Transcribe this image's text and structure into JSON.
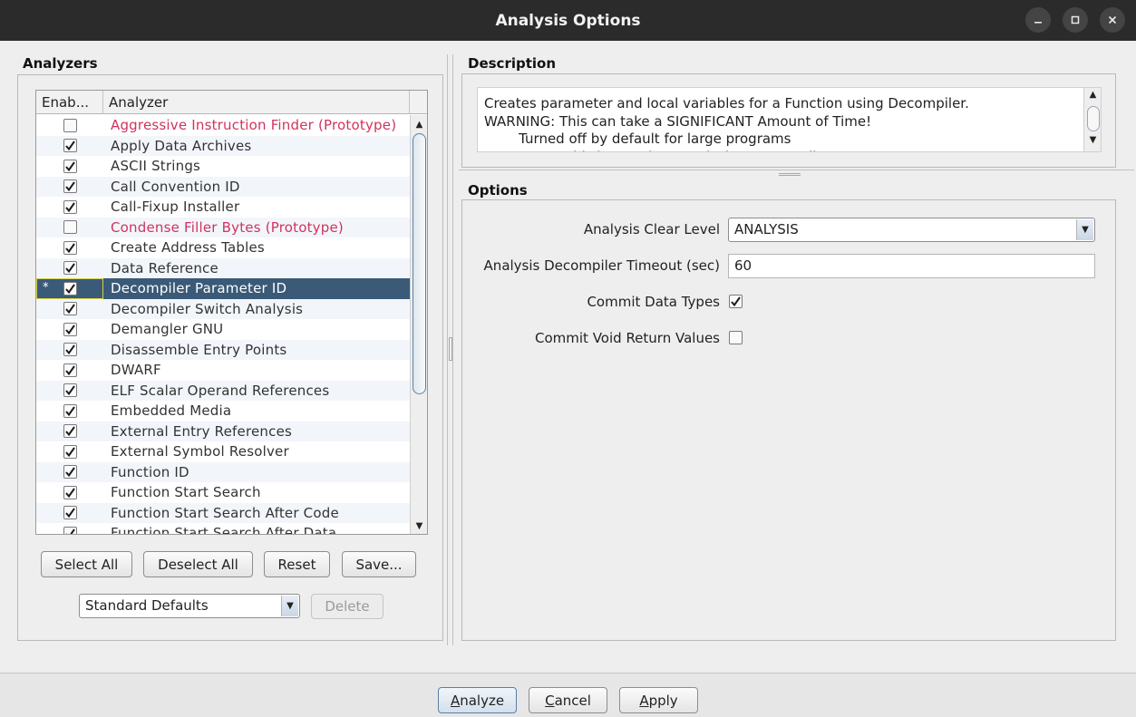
{
  "window": {
    "title": "Analysis Options",
    "controls": [
      "minimize-icon",
      "maximize-icon",
      "close-icon"
    ]
  },
  "analyzers": {
    "section_title": "Analyzers",
    "columns": [
      "Enab...",
      "Analyzer"
    ],
    "rows": [
      {
        "enabled": false,
        "name": "Aggressive Instruction Finder (Prototype)",
        "prototype": true
      },
      {
        "enabled": true,
        "name": "Apply Data Archives",
        "prototype": false
      },
      {
        "enabled": true,
        "name": "ASCII Strings",
        "prototype": false
      },
      {
        "enabled": true,
        "name": "Call Convention ID",
        "prototype": false
      },
      {
        "enabled": true,
        "name": "Call-Fixup Installer",
        "prototype": false
      },
      {
        "enabled": false,
        "name": "Condense Filler Bytes (Prototype)",
        "prototype": true
      },
      {
        "enabled": true,
        "name": "Create Address Tables",
        "prototype": false
      },
      {
        "enabled": true,
        "name": "Data Reference",
        "prototype": false
      },
      {
        "enabled": true,
        "name": "Decompiler Parameter ID",
        "prototype": false,
        "selected": true,
        "marker": "*"
      },
      {
        "enabled": true,
        "name": "Decompiler Switch Analysis",
        "prototype": false
      },
      {
        "enabled": true,
        "name": "Demangler GNU",
        "prototype": false
      },
      {
        "enabled": true,
        "name": "Disassemble Entry Points",
        "prototype": false
      },
      {
        "enabled": true,
        "name": "DWARF",
        "prototype": false
      },
      {
        "enabled": true,
        "name": "ELF Scalar Operand References",
        "prototype": false
      },
      {
        "enabled": true,
        "name": "Embedded Media",
        "prototype": false
      },
      {
        "enabled": true,
        "name": "External Entry References",
        "prototype": false
      },
      {
        "enabled": true,
        "name": "External Symbol Resolver",
        "prototype": false
      },
      {
        "enabled": true,
        "name": "Function ID",
        "prototype": false
      },
      {
        "enabled": true,
        "name": "Function Start Search",
        "prototype": false
      },
      {
        "enabled": true,
        "name": "Function Start Search After Code",
        "prototype": false
      },
      {
        "enabled": true,
        "name": "Function Start Search After Data",
        "prototype": false
      }
    ],
    "buttons": {
      "select_all": "Select All",
      "deselect_all": "Deselect All",
      "reset": "Reset",
      "save": "Save..."
    },
    "profile": {
      "selected": "Standard Defaults",
      "delete_label": "Delete"
    }
  },
  "description": {
    "section_title": "Description",
    "lines": [
      "Creates parameter and local variables for a Function using Decompiler.",
      "WARNING: This can take a SIGNIFICANT Amount of Time!",
      "        Turned off by default for large programs",
      "You can run this later using \"Analysis->Decompiler Parameter ID\""
    ]
  },
  "options": {
    "section_title": "Options",
    "clear_level_label": "Analysis Clear Level",
    "clear_level_value": "ANALYSIS",
    "timeout_label": "Analysis Decompiler Timeout (sec)",
    "timeout_value": "60",
    "commit_data_types_label": "Commit Data Types",
    "commit_data_types": true,
    "commit_void_label": "Commit Void Return Values",
    "commit_void": false
  },
  "footer": {
    "analyze_pre": "",
    "analyze_key": "A",
    "analyze_post": "nalyze",
    "cancel_key": "C",
    "cancel_post": "ancel",
    "apply_key": "A",
    "apply_post": "pply"
  }
}
